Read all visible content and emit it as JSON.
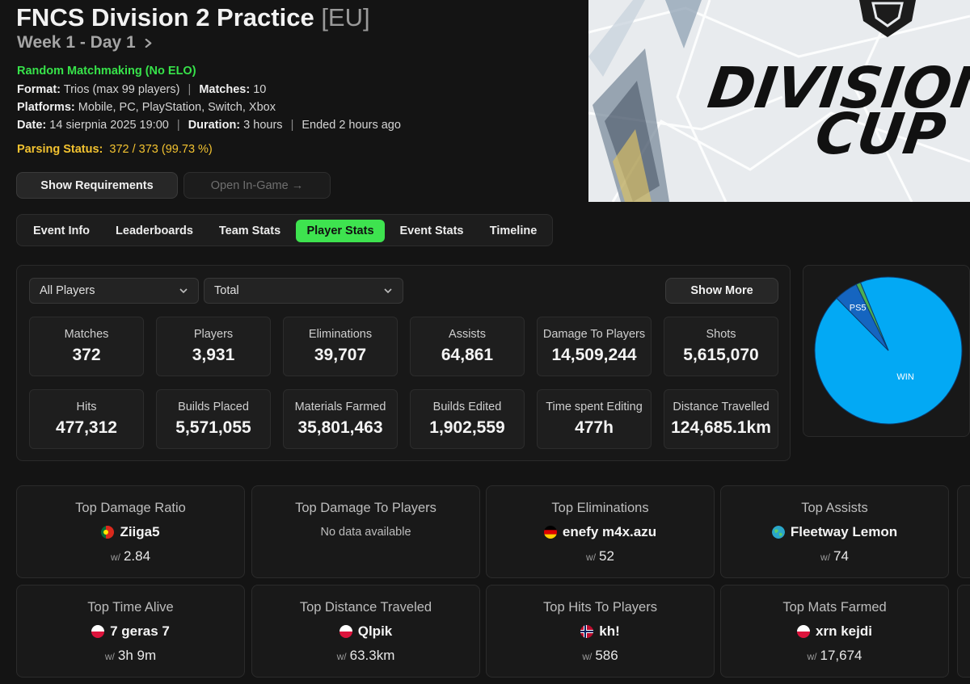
{
  "event": {
    "title": "FNCS Division 2 Practice",
    "region": "[EU]",
    "subtitle": "Week 1 - Day 1",
    "matchmaking": "Random Matchmaking (No ELO)",
    "format_label": "Format:",
    "format_value": "Trios (max 99 players)",
    "matches_label": "Matches:",
    "matches_value": "10",
    "platforms_label": "Platforms:",
    "platforms_value": "Mobile, PC, PlayStation, Switch, Xbox",
    "date_label": "Date:",
    "date_value": "14 sierpnia 2025 19:00",
    "duration_label": "Duration:",
    "duration_value": "3 hours",
    "ended": "Ended 2 hours ago",
    "separator": "|",
    "parsing_label": "Parsing Status:",
    "parsing_value": "372 / 373 (99.73 %)"
  },
  "buttons": {
    "show_requirements": "Show Requirements",
    "open_in_game": "Open In-Game →",
    "show_more": "Show More"
  },
  "banner": {
    "line1": "DIVISION",
    "line2": "CUP"
  },
  "tabs": [
    {
      "label": "Event Info"
    },
    {
      "label": "Leaderboards"
    },
    {
      "label": "Team Stats"
    },
    {
      "label": "Player Stats",
      "active": true
    },
    {
      "label": "Event Stats"
    },
    {
      "label": "Timeline"
    }
  ],
  "filters": {
    "players": "All Players",
    "mode": "Total"
  },
  "stats": [
    {
      "label": "Matches",
      "value": "372"
    },
    {
      "label": "Players",
      "value": "3,931"
    },
    {
      "label": "Eliminations",
      "value": "39,707"
    },
    {
      "label": "Assists",
      "value": "64,861"
    },
    {
      "label": "Damage To Players",
      "value": "14,509,244"
    },
    {
      "label": "Shots",
      "value": "5,615,070"
    },
    {
      "label": "Hits",
      "value": "477,312"
    },
    {
      "label": "Builds Placed",
      "value": "5,571,055"
    },
    {
      "label": "Materials Farmed",
      "value": "35,801,463"
    },
    {
      "label": "Builds Edited",
      "value": "1,902,559"
    },
    {
      "label": "Time spent Editing",
      "value": "477h"
    },
    {
      "label": "Distance Travelled",
      "value": "124,685.1km"
    }
  ],
  "chart_data": {
    "type": "pie",
    "slices": [
      {
        "label": "WIN",
        "value": 93.8,
        "color": "#03a9f4"
      },
      {
        "label": "PS5",
        "value": 5.2,
        "color": "#1565c0"
      },
      {
        "label": "",
        "value": 1.0,
        "color": "#4caf50"
      }
    ]
  },
  "top_cards": [
    {
      "title": "Top Damage Ratio",
      "player": "Ziiga5",
      "flag": "pt",
      "prefix": "w/",
      "value": "2.84"
    },
    {
      "title": "Top Damage To Players",
      "no_data": "No data available"
    },
    {
      "title": "Top Eliminations",
      "player": "enefy m4x.azu",
      "flag": "de",
      "prefix": "w/",
      "value": "52"
    },
    {
      "title": "Top Assists",
      "player": "Fleetway Lemon",
      "flag": "globe",
      "prefix": "w/",
      "value": "74"
    },
    {
      "title": "Top Time Alive",
      "player": "7 geras 7",
      "flag": "pl",
      "prefix": "w/",
      "value": "3h 9m"
    },
    {
      "title": "Top Distance Traveled",
      "player": "Qlpik",
      "flag": "pl",
      "prefix": "w/",
      "value": "63.3km"
    },
    {
      "title": "Top Hits To Players",
      "player": "kh!",
      "flag": "no",
      "prefix": "w/",
      "value": "586"
    },
    {
      "title": "Top Mats Farmed",
      "player": "xrn kejdi",
      "flag": "pl",
      "prefix": "w/",
      "value": "17,674"
    }
  ]
}
